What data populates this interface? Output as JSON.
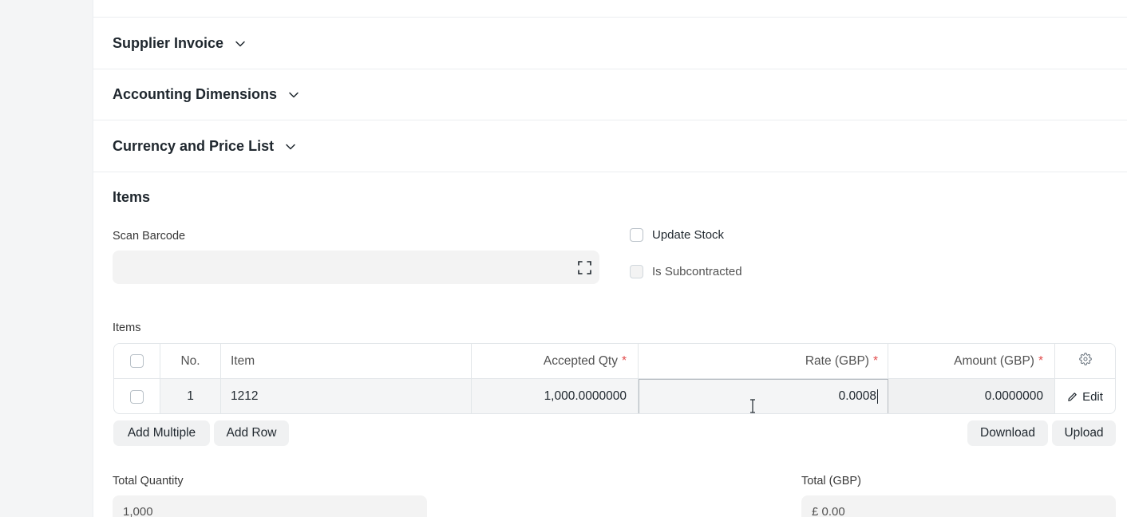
{
  "sections": {
    "supplier_invoice": "Supplier Invoice",
    "accounting_dimensions": "Accounting Dimensions",
    "currency_price_list": "Currency and Price List"
  },
  "items_section": {
    "title": "Items",
    "scan_barcode_label": "Scan Barcode",
    "scan_barcode_value": "",
    "update_stock_label": "Update Stock",
    "is_subcontracted_label": "Is Subcontracted"
  },
  "items_table": {
    "label": "Items",
    "headers": {
      "no": "No.",
      "item": "Item",
      "accepted_qty": "Accepted Qty",
      "rate": "Rate (GBP)",
      "amount": "Amount (GBP)",
      "required_mark": "*"
    },
    "rows": [
      {
        "no": "1",
        "item": "1212",
        "accepted_qty": "1,000.0000000",
        "rate": "0.0008",
        "amount": "0.0000000",
        "edit_label": "Edit"
      }
    ],
    "buttons": {
      "add_multiple": "Add Multiple",
      "add_row": "Add Row",
      "download": "Download",
      "upload": "Upload"
    }
  },
  "totals": {
    "total_quantity_label": "Total Quantity",
    "total_quantity_value": "1,000",
    "total_gbp_label": "Total (GBP)",
    "total_gbp_value": "£ 0.00"
  },
  "icons": {
    "chevron": "chevron-down-icon",
    "scan": "scan-icon",
    "gear": "gear-icon",
    "edit": "pencil-icon"
  }
}
